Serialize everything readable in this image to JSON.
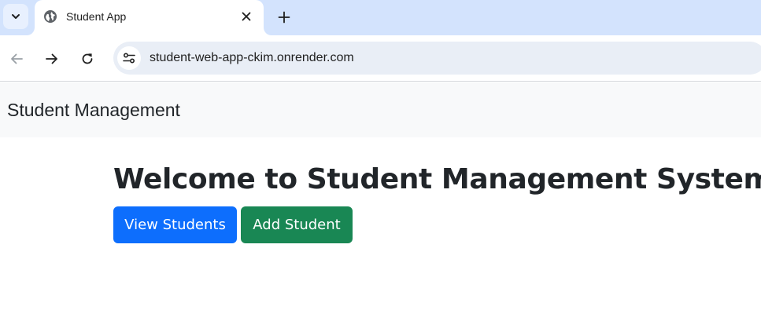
{
  "browser": {
    "tab": {
      "title": "Student App",
      "favicon": "globe-icon"
    },
    "address_bar": {
      "url": "student-web-app-ckim.onrender.com"
    },
    "icons": {
      "tab_search": "chevron-down-icon",
      "close_tab": "close-icon",
      "new_tab": "plus-icon",
      "back": "arrow-left-icon",
      "forward": "arrow-right-icon",
      "reload": "reload-icon",
      "site_info": "tune-icon"
    },
    "colors": {
      "tabstrip_bg": "#d3e3fd",
      "omnibox_bg": "#e9eef6"
    }
  },
  "page": {
    "navbar": {
      "brand": "Student Management"
    },
    "main": {
      "heading": "Welcome to Student Management System",
      "buttons": {
        "view_students": "View Students",
        "add_student": "Add Student"
      }
    },
    "colors": {
      "primary": "#0d6efd",
      "success": "#198754",
      "navbar_bg": "#f8f9fa",
      "text": "#212529"
    }
  }
}
